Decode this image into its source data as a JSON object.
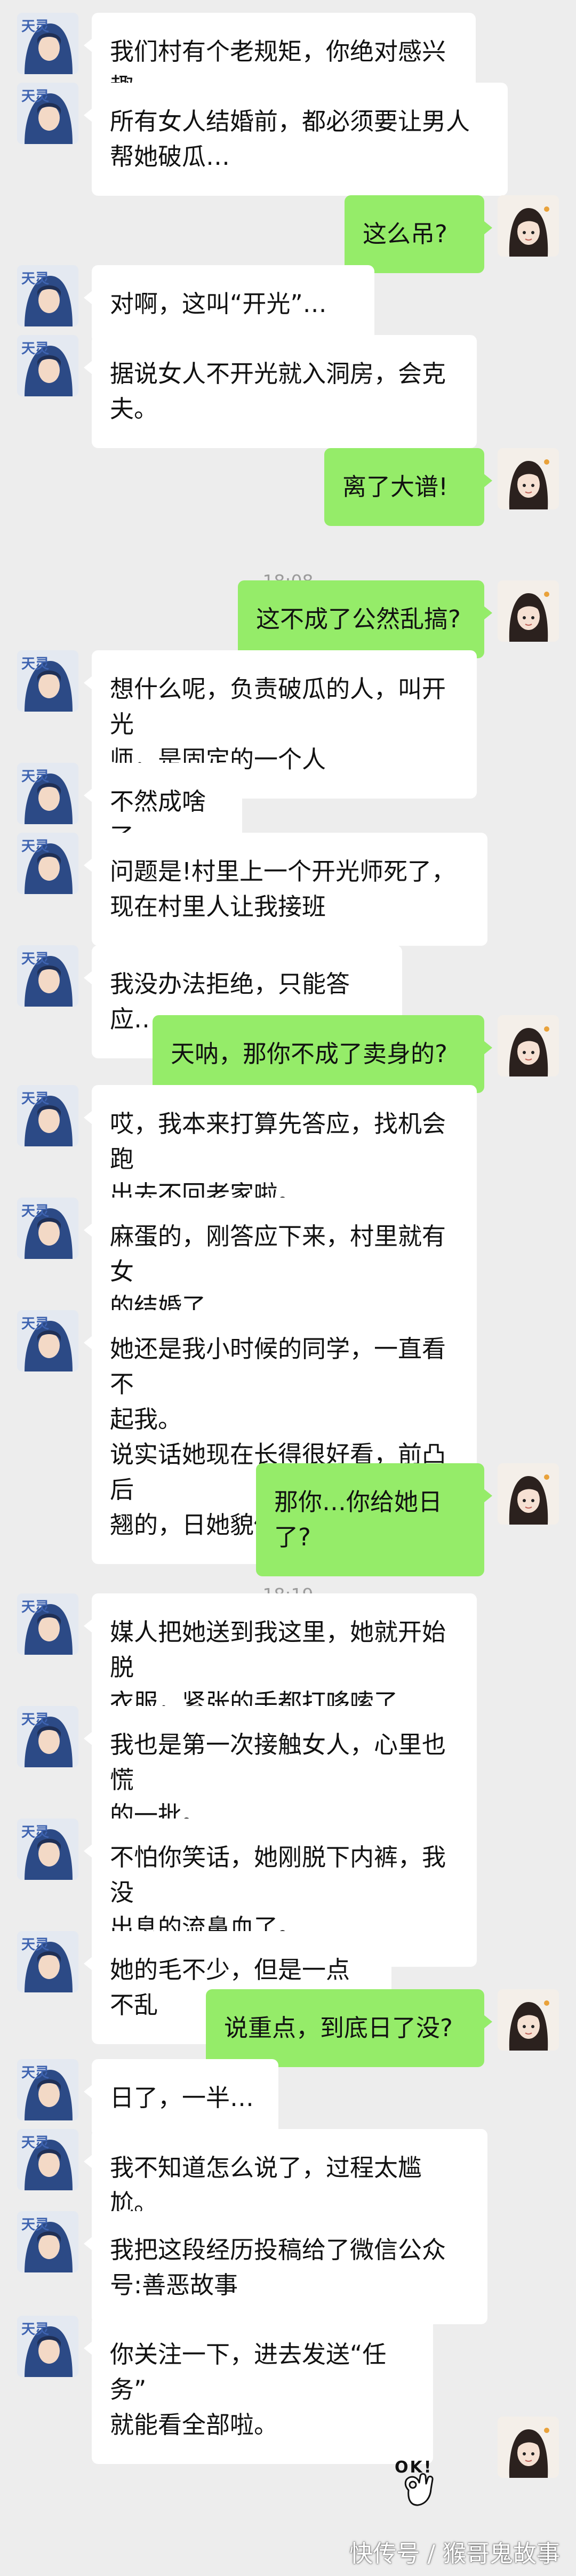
{
  "messages": [
    {
      "type": "msg",
      "side": "left",
      "text": "我们村有个老规矩，你绝对感兴趣"
    },
    {
      "type": "msg",
      "side": "left",
      "text": "所有女人结婚前，都必须要让男人\n帮她破瓜…"
    },
    {
      "type": "msg",
      "side": "right",
      "text": "这么吊?"
    },
    {
      "type": "msg",
      "side": "left",
      "text": "对啊，这叫“开光”…"
    },
    {
      "type": "msg",
      "side": "left",
      "text": "据说女人不开光就入洞房，会克\n夫。"
    },
    {
      "type": "msg",
      "side": "right",
      "text": "离了大谱!"
    },
    {
      "type": "time",
      "text": "18:08"
    },
    {
      "type": "msg",
      "side": "right",
      "text": "这不成了公然乱搞?"
    },
    {
      "type": "msg",
      "side": "left",
      "text": "想什么呢，负责破瓜的人，叫开光\n师，是固定的一个人"
    },
    {
      "type": "msg",
      "side": "left",
      "text": "不然成啥了"
    },
    {
      "type": "msg",
      "side": "left",
      "text": "问题是!村里上一个开光师死了，\n现在村里人让我接班"
    },
    {
      "type": "msg",
      "side": "left",
      "text": "我没办法拒绝，只能答应…"
    },
    {
      "type": "msg",
      "side": "right",
      "text": "天呐，那你不成了卖身的?"
    },
    {
      "type": "msg",
      "side": "left",
      "text": "哎，我本来打算先答应，找机会跑\n出去不回老家啦。"
    },
    {
      "type": "msg",
      "side": "left",
      "text": "麻蛋的，刚答应下来，村里就有女\n的结婚了"
    },
    {
      "type": "msg",
      "side": "left",
      "text": "她还是我小时候的同学，一直看不\n起我。\n说实话她现在长得很好看，前凸后\n翘的，日她貌似不亏😁"
    },
    {
      "type": "msg",
      "side": "right",
      "text": "那你…你给她日了?"
    },
    {
      "type": "time",
      "text": "18:19"
    },
    {
      "type": "msg",
      "side": "left",
      "text": "媒人把她送到我这里，她就开始脱\n衣服，紧张的手都打哆嗦了"
    },
    {
      "type": "msg",
      "side": "left",
      "text": "我也是第一次接触女人，心里也慌\n的一批。"
    },
    {
      "type": "msg",
      "side": "left",
      "text": "不怕你笑话，她刚脱下内裤，我没\n出息的流鼻血了。"
    },
    {
      "type": "msg",
      "side": "left",
      "text": "她的毛不少，但是一点不乱"
    },
    {
      "type": "msg",
      "side": "right",
      "text": "说重点，到底日了没?"
    },
    {
      "type": "msg",
      "side": "left",
      "text": "日了，一半…"
    },
    {
      "type": "msg",
      "side": "left",
      "text": "我不知道怎么说了，过程太尴尬。"
    },
    {
      "type": "msg",
      "side": "left",
      "text": "我把这段经历投稿给了微信公众\n号:善恶故事"
    },
    {
      "type": "msg",
      "side": "left",
      "text": "你关注一下，进去发送“任务”\n就能看全部啦。"
    },
    {
      "type": "avatar_only",
      "side": "right"
    }
  ],
  "sticker": {
    "text": "OK!",
    "icon": "ok-hand-icon"
  },
  "watermark": "快传号 / 猴哥鬼故事",
  "colors": {
    "background": "#ededed",
    "left_bubble": "#ffffff",
    "right_bubble": "#95ec69",
    "timestamp": "#9b9b9b"
  }
}
